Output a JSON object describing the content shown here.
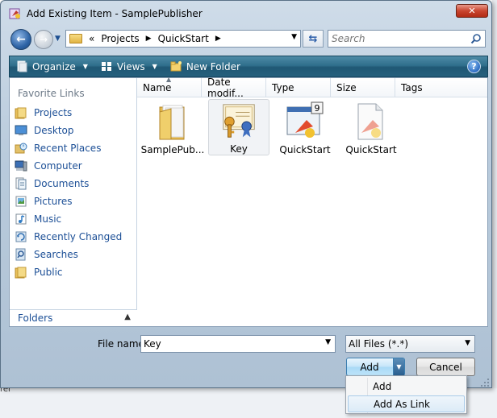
{
  "window": {
    "title": "Add Existing Item - SamplePublisher"
  },
  "address": {
    "overflow": "«",
    "crumbs": [
      "Projects",
      "QuickStart"
    ]
  },
  "search": {
    "placeholder": "Search"
  },
  "toolbar": {
    "organize_label": "Organize",
    "views_label": "Views",
    "new_folder_label": "New Folder"
  },
  "sidebar": {
    "heading": "Favorite Links",
    "items": [
      {
        "label": "Projects",
        "icon": "folder-icon"
      },
      {
        "label": "Desktop",
        "icon": "desktop-icon"
      },
      {
        "label": "Recent Places",
        "icon": "recent-places-icon"
      },
      {
        "label": "Computer",
        "icon": "computer-icon"
      },
      {
        "label": "Documents",
        "icon": "documents-icon"
      },
      {
        "label": "Pictures",
        "icon": "pictures-icon"
      },
      {
        "label": "Music",
        "icon": "music-icon"
      },
      {
        "label": "Recently Changed",
        "icon": "recently-changed-icon"
      },
      {
        "label": "Searches",
        "icon": "searches-icon"
      },
      {
        "label": "Public",
        "icon": "folder-icon"
      }
    ],
    "folders_label": "Folders"
  },
  "columns": [
    "Name",
    "Date modif...",
    "Type",
    "Size",
    "Tags"
  ],
  "files": [
    {
      "label": "SamplePub...",
      "icon": "folder-icon",
      "selected": false
    },
    {
      "label": "Key",
      "icon": "certificate-key-icon",
      "selected": true
    },
    {
      "label": "QuickStart",
      "icon": "visual-studio-solution-icon",
      "selected": false,
      "badge": "9"
    },
    {
      "label": "QuickStart",
      "icon": "visual-studio-project-icon",
      "selected": false
    }
  ],
  "footer": {
    "filename_label": "File name:",
    "filename_value": "Key",
    "filter_value": "All Files (*.*)",
    "add_label": "Add",
    "cancel_label": "Cancel"
  },
  "add_menu": {
    "items": [
      "Add",
      "Add As Link"
    ],
    "highlighted_index": 1
  },
  "background_text": "rer"
}
